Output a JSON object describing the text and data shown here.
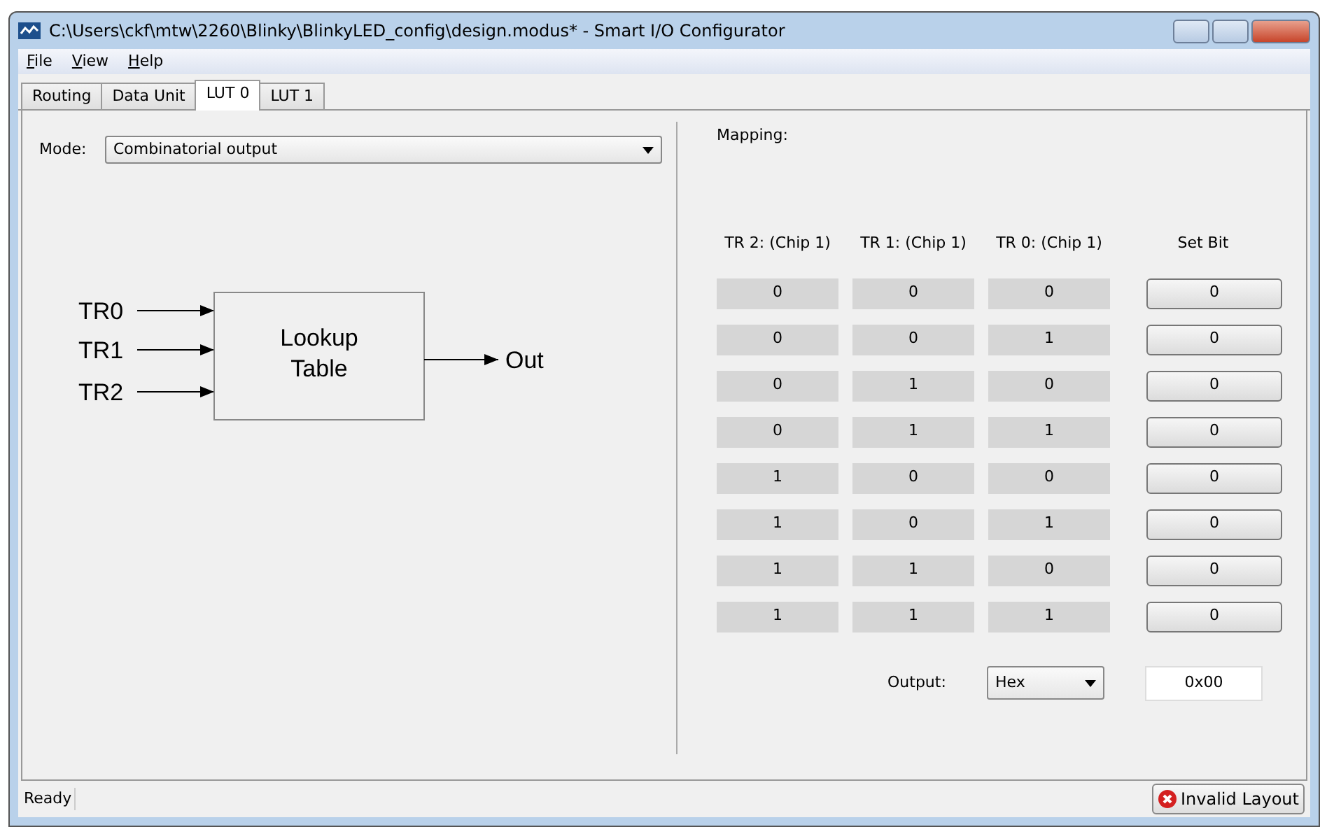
{
  "window": {
    "title": "C:\\Users\\ckf\\mtw\\2260\\Blinky\\BlinkyLED_config\\design.modus* - Smart I/O Configurator"
  },
  "menu": [
    "File",
    "View",
    "Help"
  ],
  "tabs": [
    {
      "label": "Routing",
      "selected": false
    },
    {
      "label": "Data Unit",
      "selected": false
    },
    {
      "label": "LUT 0",
      "selected": true
    },
    {
      "label": "LUT 1",
      "selected": false
    }
  ],
  "mode": {
    "label": "Mode:",
    "value": "Combinatorial output"
  },
  "diagram": {
    "inputs": [
      "TR0",
      "TR1",
      "TR2"
    ],
    "block": [
      "Lookup",
      "Table"
    ],
    "output": "Out"
  },
  "mapping": {
    "label": "Mapping:",
    "columns": [
      "TR 2:  (Chip 1)",
      "TR 1:  (Chip 1)",
      "TR 0:  (Chip 1)",
      "Set Bit"
    ],
    "rows": [
      [
        "0",
        "0",
        "0",
        "0"
      ],
      [
        "0",
        "0",
        "1",
        "0"
      ],
      [
        "0",
        "1",
        "0",
        "0"
      ],
      [
        "0",
        "1",
        "1",
        "0"
      ],
      [
        "1",
        "0",
        "0",
        "0"
      ],
      [
        "1",
        "0",
        "1",
        "0"
      ],
      [
        "1",
        "1",
        "0",
        "0"
      ],
      [
        "1",
        "1",
        "1",
        "0"
      ]
    ]
  },
  "output": {
    "label": "Output:",
    "format": "Hex",
    "value": "0x00"
  },
  "status_bar": {
    "text": "Ready",
    "badge": "Invalid Layout"
  }
}
